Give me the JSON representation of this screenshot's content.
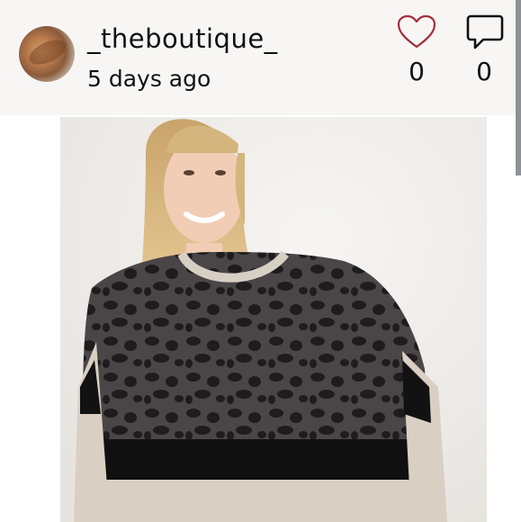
{
  "post": {
    "username": "_theboutique_",
    "time_ago": "5 days ago",
    "like_count": "0",
    "comment_count": "0"
  },
  "icons": {
    "like": "heart-outline-icon",
    "comment": "speech-bubble-icon"
  },
  "colors": {
    "header_bg": "#f7f6f5",
    "heart_stroke": "#a0303a",
    "text": "#111111"
  }
}
